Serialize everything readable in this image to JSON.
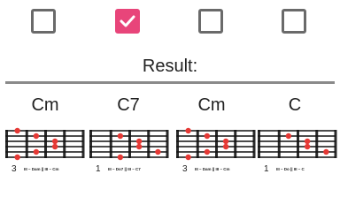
{
  "options": [
    {
      "label": "?",
      "checked": false
    },
    {
      "label": "?",
      "checked": true
    },
    {
      "label": "?",
      "checked": false
    },
    {
      "label": "?",
      "checked": false
    }
  ],
  "result": {
    "title": "Result:"
  },
  "chords": [
    {
      "name": "Cm",
      "fret_number": "3",
      "caption": "III – Dam  ||  III – Cm",
      "dots": [
        [
          0,
          0
        ],
        [
          1,
          1
        ],
        [
          2,
          2
        ],
        [
          3,
          2
        ],
        [
          4,
          1
        ],
        [
          5,
          0
        ]
      ]
    },
    {
      "name": "C7",
      "fret_number": "1",
      "caption": "III – Do7  ||  III – C7",
      "dots": [
        [
          1,
          1
        ],
        [
          2,
          2
        ],
        [
          3,
          2
        ],
        [
          4,
          3
        ],
        [
          5,
          1
        ]
      ]
    },
    {
      "name": "Cm",
      "fret_number": "3",
      "caption": "III – Dam  ||  III – Cm",
      "dots": [
        [
          0,
          0
        ],
        [
          1,
          1
        ],
        [
          2,
          2
        ],
        [
          3,
          2
        ],
        [
          4,
          1
        ],
        [
          5,
          0
        ]
      ]
    },
    {
      "name": "C",
      "fret_number": "1",
      "caption": "III – Do  ||  III – C",
      "dots": [
        [
          1,
          1
        ],
        [
          2,
          2
        ],
        [
          3,
          2
        ],
        [
          4,
          3
        ]
      ]
    }
  ],
  "colors": {
    "accent": "#e8457a",
    "dot": "#e53935",
    "string": "#111111",
    "fret": "#2a2a2a"
  }
}
